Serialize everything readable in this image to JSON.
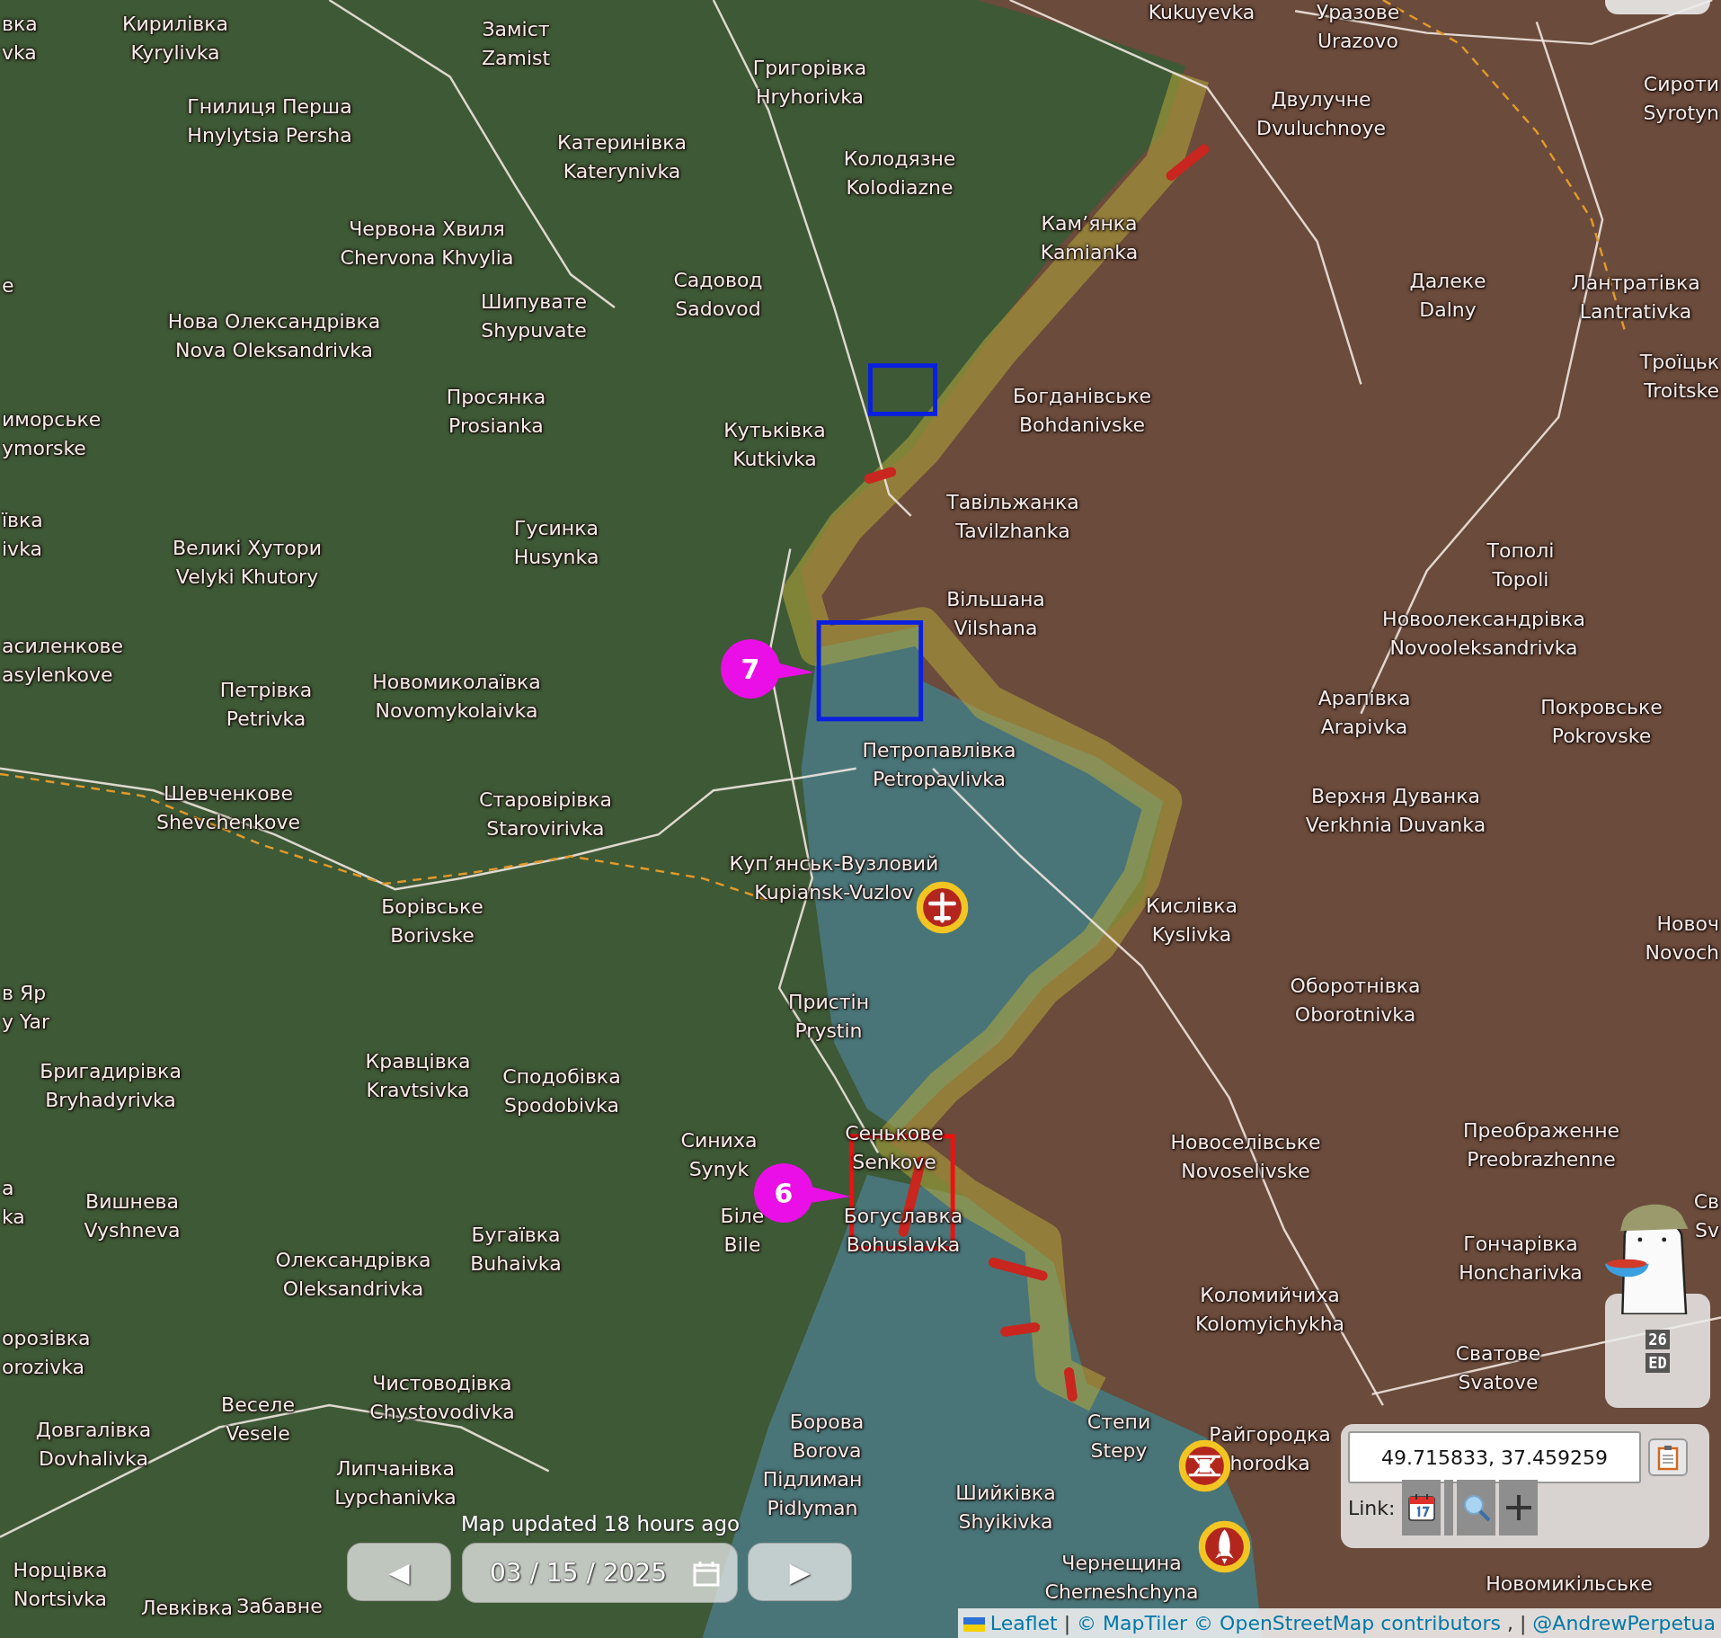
{
  "map": {
    "places": [
      {
        "uk": "вка",
        "en": "vka"
      },
      {
        "uk": "Кирилівка",
        "en": "Kyrylivka"
      },
      {
        "uk": "Заміст",
        "en": "Zamist"
      },
      {
        "en": "Kukuyevka"
      },
      {
        "uk": "Уразове",
        "en": "Urazovo"
      },
      {
        "uk": "Гнилиця Перша",
        "en": "Hnylytsia Persha"
      },
      {
        "uk": "Григорівка",
        "en": "Hryhorivka"
      },
      {
        "uk": "Двулучне",
        "en": "Dvuluchnoye"
      },
      {
        "uk": "Сироти",
        "en": "Syrotyn"
      },
      {
        "uk": "Катеринівка",
        "en": "Katerynivka"
      },
      {
        "uk": "Колодязне",
        "en": "Kolodiazne"
      },
      {
        "uk": "Червона Хвиля",
        "en": "Chervona Khvylia"
      },
      {
        "uk": "Кам’янка",
        "en": "Kamianka"
      },
      {
        "uk": "е"
      },
      {
        "uk": "Нова Олександрівка",
        "en": "Nova Oleksandrivka"
      },
      {
        "uk": "Шипувате",
        "en": "Shypuvate"
      },
      {
        "uk": "Садовод",
        "en": "Sadovod"
      },
      {
        "uk": "Далеке",
        "en": "Dalny"
      },
      {
        "uk": "Лантратівка",
        "en": "Lantrativka"
      },
      {
        "uk": "иморське",
        "en": "ymorske"
      },
      {
        "uk": "Просянка",
        "en": "Prosianka"
      },
      {
        "uk": "Кутьківка",
        "en": "Kutkivka"
      },
      {
        "uk": "Богданівське",
        "en": "Bohdanivske"
      },
      {
        "uk": "Троїцьк",
        "en": "Troitske"
      },
      {
        "uk": "ївка",
        "en": "ivka"
      },
      {
        "uk": "Великі Хутори",
        "en": "Velyki Khutory"
      },
      {
        "uk": "Гусинка",
        "en": "Husynka"
      },
      {
        "uk": "Тавільжанка",
        "en": "Tavilzhanka"
      },
      {
        "uk": "Тополі",
        "en": "Topoli"
      },
      {
        "uk": "асиленкове",
        "en": "asylenkove"
      },
      {
        "uk": "Вільшана",
        "en": "Vilshana"
      },
      {
        "uk": "Новоолександрівка",
        "en": "Novooleksandrivka"
      },
      {
        "uk": "Петрівка",
        "en": "Petrivka"
      },
      {
        "uk": "Новомиколаївка",
        "en": "Novomykolaivka"
      },
      {
        "uk": "Арапівка",
        "en": "Arapivka"
      },
      {
        "uk": "Покровське",
        "en": "Pokrovske"
      },
      {
        "uk": "Петропавлівка",
        "en": "Petropavlivka"
      },
      {
        "uk": "Шевченкове",
        "en": "Shevchenkove"
      },
      {
        "uk": "Старовірівка",
        "en": "Starovirivka"
      },
      {
        "uk": "Верхня Дуванка",
        "en": "Verkhnia Duvanka"
      },
      {
        "uk": "Борівське",
        "en": "Borivske"
      },
      {
        "uk": "Куп’янськ-Вузловий",
        "en": "Kupiansk-Vuzlov"
      },
      {
        "uk": "Кислівка",
        "en": "Kyslivka"
      },
      {
        "uk": "Новоч",
        "en": "Novoch"
      },
      {
        "uk": "в Яр",
        "en": "y Yar"
      },
      {
        "uk": "Пристін",
        "en": "Prystin"
      },
      {
        "uk": "Оборотнівка",
        "en": "Oborotnivka"
      },
      {
        "uk": "Бригадирівка",
        "en": "Bryhadyrivka"
      },
      {
        "uk": "Кравцівка",
        "en": "Kravtsivka"
      },
      {
        "uk": "Сподобівка",
        "en": "Spodobivka"
      },
      {
        "uk": "Синиха",
        "en": "Synyk"
      },
      {
        "uk": "Сенькове",
        "en": "Senkove"
      },
      {
        "uk": "Новоселівське",
        "en": "Novoselivske"
      },
      {
        "uk": "Преображенне",
        "en": "Preobrazhenne"
      },
      {
        "uk": "а",
        "en": "ka"
      },
      {
        "uk": "Вишнева",
        "en": "Vyshneva"
      },
      {
        "uk": "Біле",
        "en": "Bile"
      },
      {
        "uk": "Богуславка",
        "en": "Bohuslavka"
      },
      {
        "uk": "Св",
        "en": "Sv"
      },
      {
        "uk": "Олександрівка",
        "en": "Oleksandrivka"
      },
      {
        "uk": "Бугаївка",
        "en": "Buhaivka"
      },
      {
        "uk": "Гончарівка",
        "en": "Honcharivka"
      },
      {
        "uk": "Коломийчиха",
        "en": "Kolomyichykha"
      },
      {
        "uk": "орозівка",
        "en": "orozivka"
      },
      {
        "uk": "Сватове",
        "en": "Svatove"
      },
      {
        "uk": "Довгалівка",
        "en": "Dovhalivka"
      },
      {
        "uk": "Веселе",
        "en": "Vesele"
      },
      {
        "uk": "Чистоводівка",
        "en": "Chystovodivka"
      },
      {
        "uk": "Борова",
        "en": "Borova"
      },
      {
        "uk": "Степи",
        "en": "Stepy"
      },
      {
        "uk": "Райгородка",
        "en": "horodka"
      },
      {
        "uk": "Липчанівка",
        "en": "Lypchanivka"
      },
      {
        "uk": "Підлиман",
        "en": "Pidlyman"
      },
      {
        "uk": "Шийківка",
        "en": "Shyikivka"
      },
      {
        "uk": "Норцівка",
        "en": "Nortsivka"
      },
      {
        "uk": "Чернещина",
        "en": "Cherneshchyna"
      },
      {
        "uk": "Новомикільське"
      },
      {
        "uk": "Левківка"
      },
      {
        "uk": "Забавне"
      }
    ],
    "callouts": [
      {
        "label": "7"
      },
      {
        "label": "6"
      }
    ],
    "markers": [
      {
        "kind": "aircraft"
      },
      {
        "kind": "drone"
      },
      {
        "kind": "rocket"
      }
    ]
  },
  "date_bar": {
    "status": "Map updated 18 hours ago",
    "prev": "◀",
    "date": "03 / 15 / 2025",
    "next": "▶"
  },
  "widget": {
    "lines": [
      "26",
      "ED"
    ]
  },
  "coords_panel": {
    "value": "49.715833, 37.459259",
    "link_label": "Link:"
  },
  "attribution": [
    {
      "kind": "link",
      "text": "Leaflet",
      "flag": true
    },
    {
      "kind": "sep",
      "text": "|"
    },
    {
      "kind": "link",
      "text": "© MapTiler"
    },
    {
      "kind": "link",
      "text": "© OpenStreetMap contributors"
    },
    {
      "kind": "sep",
      "text": ", |"
    },
    {
      "kind": "link",
      "text": "@AndrewPerpetua"
    }
  ]
}
